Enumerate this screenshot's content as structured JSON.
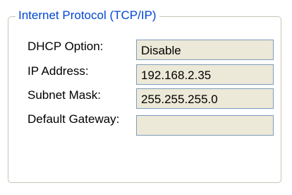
{
  "group": {
    "title": "Internet Protocol (TCP/IP)"
  },
  "fields": [
    {
      "label": "DHCP Option:",
      "value": "Disable"
    },
    {
      "label": "IP Address:",
      "value": "192.168.2.35"
    },
    {
      "label": "Subnet Mask:",
      "value": "255.255.255.0"
    },
    {
      "label": "Default Gateway:",
      "value": ""
    }
  ],
  "colors": {
    "legend_text": "#0046d5",
    "field_background": "#ece9d8",
    "field_border": "#7f9db9",
    "group_border": "#c9c5b6"
  }
}
